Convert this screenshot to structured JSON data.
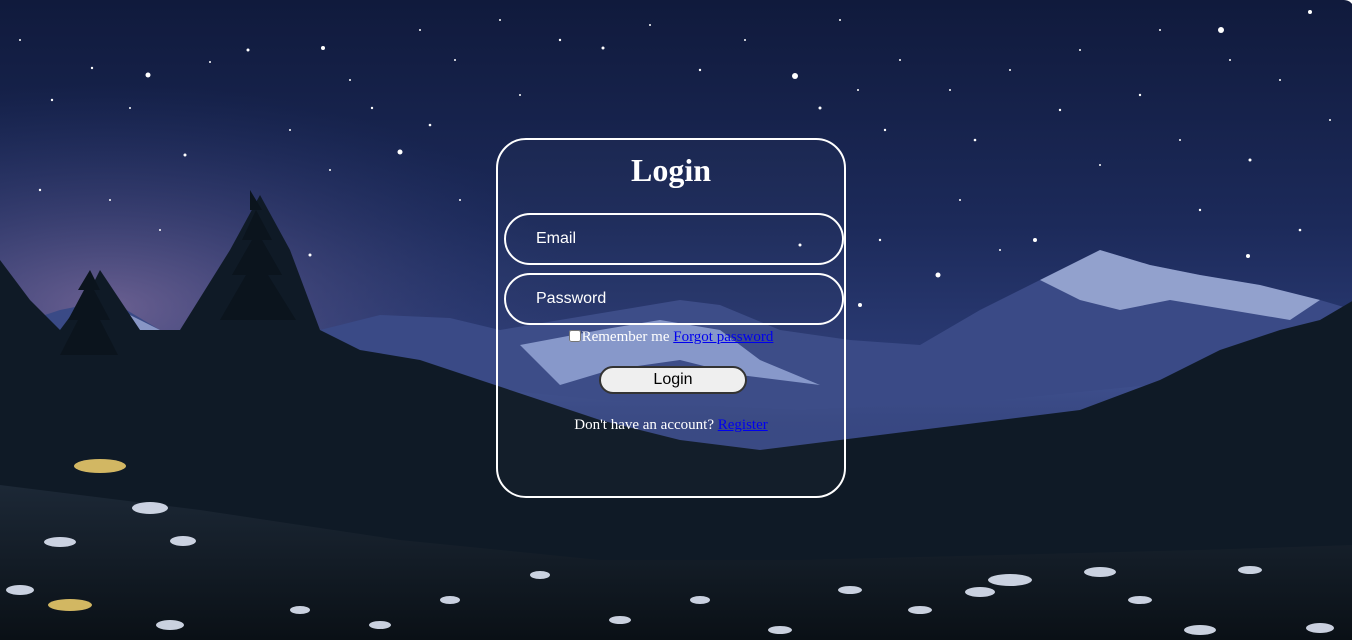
{
  "login_form": {
    "title": "Login",
    "email_placeholder": "Email",
    "password_placeholder": "Password",
    "remember_label": "Remember me",
    "forgot_link": "Forgot password",
    "submit_label": "Login",
    "no_account_text": "Don't have an account? ",
    "register_link": "Register"
  },
  "colors": {
    "card_border": "#ffffff",
    "link": "#0000ee",
    "button_bg": "#efefef"
  }
}
